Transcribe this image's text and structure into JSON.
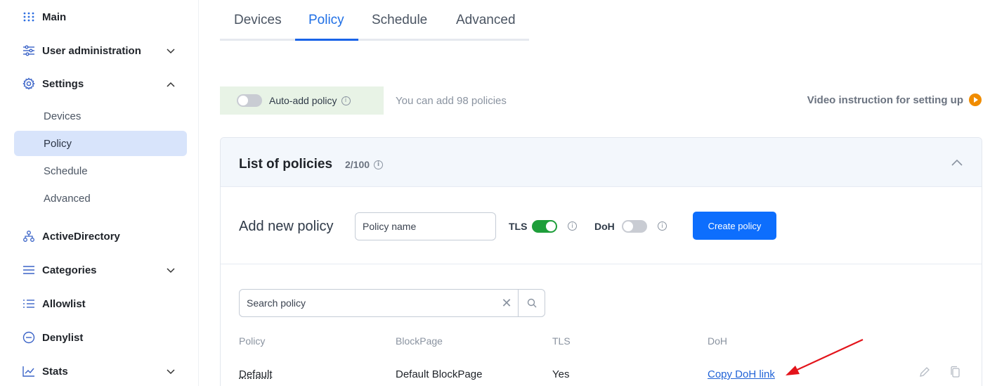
{
  "sidebar": {
    "main": "Main",
    "user_admin": "User administration",
    "settings": "Settings",
    "sub": [
      "Devices",
      "Policy",
      "Schedule",
      "Advanced"
    ],
    "active_directory": "ActiveDirectory",
    "categories": "Categories",
    "allowlist": "Allowlist",
    "denylist": "Denylist",
    "stats": "Stats"
  },
  "tabs": [
    "Devices",
    "Policy",
    "Schedule",
    "Advanced"
  ],
  "active_tab": "Policy",
  "auto_add": {
    "label": "Auto-add policy",
    "info": "i",
    "enabled": false
  },
  "can_add": "You can add 98 policies",
  "video_instruction": "Video instruction for setting up",
  "policies_card": {
    "title": "List of policies",
    "count": "2/100",
    "add_label": "Add new policy",
    "name_placeholder": "Policy name",
    "tls_label": "TLS",
    "tls_enabled": true,
    "doh_label": "DoH",
    "doh_enabled": false,
    "create_button": "Create policy",
    "search_placeholder": "Search policy",
    "columns": [
      "Policy",
      "BlockPage",
      "TLS",
      "DoH"
    ],
    "rows": [
      {
        "policy": "Default",
        "blockpage": "Default BlockPage",
        "tls": "Yes",
        "doh": "Copy DoH link"
      }
    ]
  },
  "colors": {
    "accent": "#1a64e8",
    "primary_button": "#0d6efd",
    "toggle_on": "#1e9e3a",
    "sidebar_active": "#d8e4fb",
    "annotation_arrow": "#e3141b",
    "play_icon": "#f08c00"
  }
}
